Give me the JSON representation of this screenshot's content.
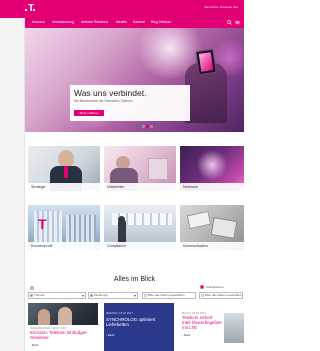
{
  "brand": {
    "logo_glyph": "T",
    "color": "#e20074"
  },
  "topbar": {
    "right_text": "Deutsche Telekom AG"
  },
  "nav": {
    "items": [
      "Konzern",
      "Verantwortung",
      "Investor Relations",
      "Medien",
      "Karriere",
      "Blog Telekom"
    ],
    "icons": [
      "search-icon",
      "menu-icon"
    ]
  },
  "hero": {
    "title": "Was uns verbindet.",
    "subtitle": "Die Markenwerte der Deutschen Telekom",
    "button": "Mehr erfahren",
    "pager": "1/4"
  },
  "tiles": [
    {
      "label": "Strategie"
    },
    {
      "label": "Mitarbeiter"
    },
    {
      "label": "Netzwerk"
    },
    {
      "label": "Konzernprofil"
    },
    {
      "label": "Compliance"
    },
    {
      "label": "Kommunikation"
    }
  ],
  "section": {
    "title": "Alles im Blick",
    "reset": "Zurücksetzen",
    "filters": [
      {
        "icon": "themes-icon",
        "value": "Themen"
      },
      {
        "icon": "media-icon",
        "value": "Medientyp"
      },
      {
        "icon": "calendar-icon",
        "value": "Bitte das Datum auswählen"
      },
      {
        "icon": "calendar-icon",
        "value": "Bitte das Datum auswählen"
      }
    ]
  },
  "cards": [
    {
      "meta": "NACHRICHTEN | 18.07.2017",
      "title": "Ericsson: Telekom ist Budget-Gewinner",
      "more": "› Mehr"
    },
    {
      "meta": "MEDIEN | 18.07.2017",
      "title": "SYNCHROLOG optimiert Lieferketten",
      "more": "› Mehr"
    },
    {
      "meta": "BLOG | 18.07.2017",
      "title": "Telekom sichert Intel-Gewerbegebiet mit LTE",
      "more": "› Mehr"
    }
  ]
}
